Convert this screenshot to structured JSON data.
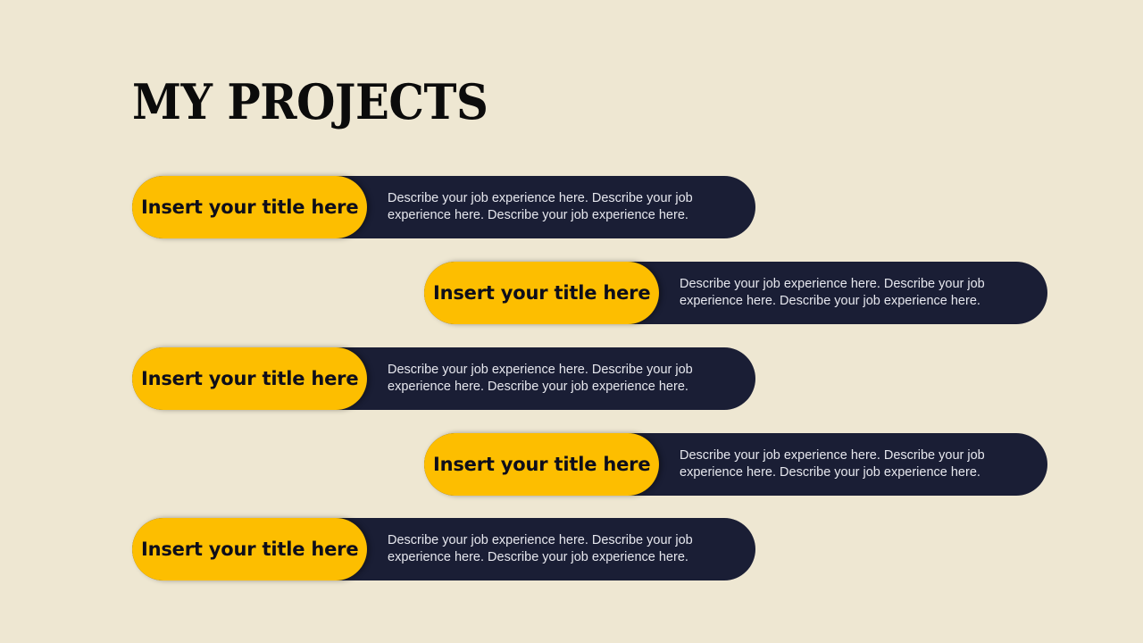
{
  "slide": {
    "title": "MY PROJECTS"
  },
  "projects": [
    {
      "title": "Insert your title here",
      "description": "Describe your job experience here. Describe your job experience here. Describe your job experience here."
    },
    {
      "title": "Insert your title here",
      "description": "Describe your job experience here. Describe your job experience here. Describe your job experience here."
    },
    {
      "title": "Insert your title here",
      "description": "Describe your job experience here. Describe your job experience here. Describe your job experience here."
    },
    {
      "title": "Insert your title here",
      "description": "Describe your job experience here. Describe your job experience here. Describe your job experience here."
    },
    {
      "title": "Insert your title here",
      "description": "Describe your job experience here. Describe your job experience here. Describe your job experience here."
    }
  ],
  "colors": {
    "background": "#EEE7D2",
    "accent": "#FDBE00",
    "pill_dark": "#1A1E35",
    "title_text": "#0B0B0B"
  }
}
